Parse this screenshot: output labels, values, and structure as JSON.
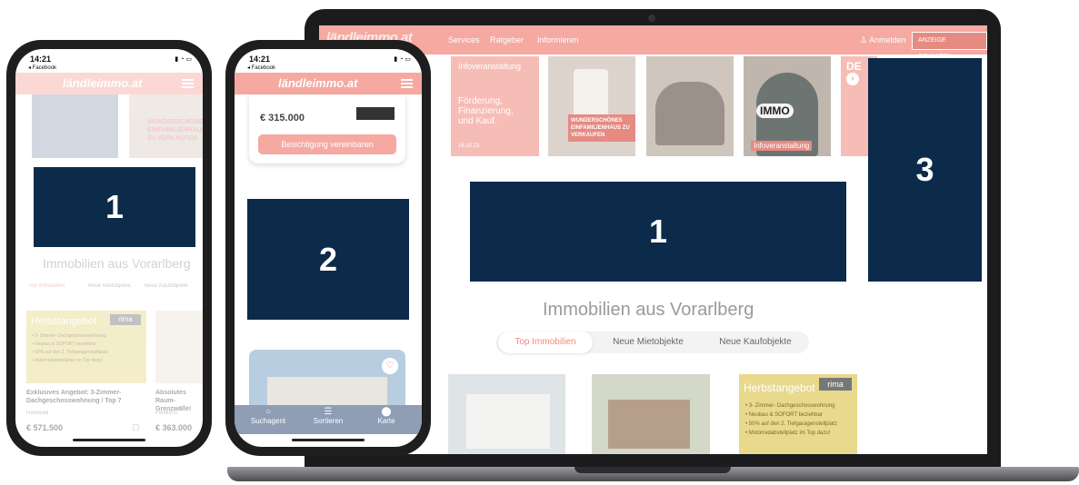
{
  "laptop": {
    "logo_text": "ländleimmo.at",
    "nav": [
      "Services",
      "Ratgeber",
      "Informieren"
    ],
    "login": "Anmelden",
    "cta": "ANZEIGE SCHALTEN",
    "tiles": {
      "t1_title": "Infoveranstaltung",
      "t1_body": "Förderung, Finanzierung, und Kauf.",
      "t1_date": "16.10.23",
      "t2_label": "WUNDERSCHÖNES EINFAMILIENHAUS ZU VERKAUFEN",
      "t4_badge": "IMMO",
      "t4_caption": "Infoveranstaltung",
      "t5_text": "DE"
    },
    "block1": "1",
    "block3": "3",
    "section_title": "Immobilien aus Vorarlberg",
    "tabs": [
      "Top Immobilien",
      "Neue Mietobjekte",
      "Neue Kaufobjekte"
    ],
    "card3": {
      "heading": "Herbstangebot",
      "brand": "rima",
      "bullets": [
        "• 3- Zimmer- Dachgeschosswohnung",
        "• Neubau & SOFORT beziehbar",
        "• 50% auf den 2. Tiefgaragenstellplatz",
        "• Motorradabstellplatz im Top dazu!"
      ]
    }
  },
  "phone1": {
    "time": "14:21",
    "back": "◂ Facebook",
    "logo": "ländleimmo.at",
    "tile_text": "WUNDERSCHÖNES EINFAMILIENHAUS ZU VERKAUFEN",
    "block": "1",
    "section_title": "Immobilien aus Vorarlberg",
    "tabs": [
      "Top Immobilien",
      "Neue Mietobjekte",
      "Neue Kaufobjekte"
    ],
    "card_heading": "Herbstangebot",
    "card_brand": "rima",
    "card_bullets": [
      "• 3- Zimmer- Dachgeschosswohnung",
      "• Neubau & SOFORT beziehbar",
      "• 50% auf den 2. Tiefgaragenstellplatz",
      "• Motorradabstellplatz im Top dazu!"
    ],
    "listing1_title": "Exklusives Angebot: 3-Zimmer-Dachgeschosswohnung / Top 7",
    "listing1_place": "Rankweil",
    "listing1_price": "€ 571.500",
    "listing2_title": "Absolutes Raum-Grenzwälle!",
    "listing2_place": "Feldkirch",
    "listing2_price": "€ 363.000"
  },
  "phone2": {
    "time": "14:21",
    "back": "◂ Facebook",
    "logo": "ländleimmo.at",
    "price": "€ 315.000",
    "button": "Besichtigung vereinbaren",
    "block": "2",
    "bottom_nav": [
      "Suchagent",
      "Sortieren",
      "Karte"
    ]
  }
}
